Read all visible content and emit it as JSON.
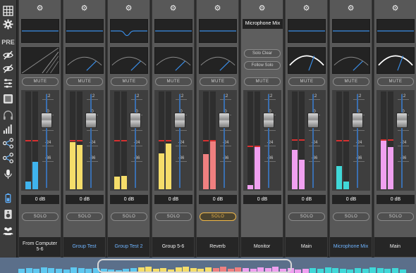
{
  "toolbar": {
    "icons": [
      "grid-icon",
      "gear-icon",
      "pre-label",
      "eye-off-icon",
      "eye-off-icon",
      "list-icon",
      "square-icon",
      "headphones-icon",
      "levels-icon",
      "routing-icon",
      "routing-icon",
      "mic-icon",
      "battery-icon",
      "speaker-icon",
      "group-icon"
    ],
    "pre_label": "PRE"
  },
  "channels": [
    {
      "name": "From Computer 5-6",
      "name_color": "white",
      "gain": "0 dB",
      "mute": "MUTE",
      "solo": "SOLO",
      "solo_active": false,
      "meter_color": "#3fb4ee",
      "meter_levels": [
        0.08,
        0.28
      ],
      "peak": 0.49,
      "fader": 0.75,
      "eq": "flat",
      "dyn": "ramp"
    },
    {
      "name": "Group Test",
      "name_color": "blue",
      "gain": "0 dB",
      "mute": "MUTE",
      "solo": "SOLO",
      "solo_active": false,
      "meter_color": "#f5dd6a",
      "meter_levels": [
        0.48,
        0.45
      ],
      "peak": 0.49,
      "fader": 0.75,
      "eq": "flat",
      "dyn": "arc"
    },
    {
      "name": "Group Test 2",
      "name_color": "blue",
      "gain": "0 dB",
      "mute": "MUTE",
      "solo": "SOLO",
      "solo_active": false,
      "meter_color": "#f5dd6a",
      "meter_levels": [
        0.13,
        0.14
      ],
      "peak": 0.49,
      "fader": 0.75,
      "eq": "dip",
      "dyn": "arc"
    },
    {
      "name": "Group 5-6",
      "name_color": "white",
      "gain": "0 dB",
      "mute": "MUTE",
      "solo": "SOLO",
      "solo_active": false,
      "meter_color": "#f5dd6a",
      "meter_levels": [
        0.37,
        0.47
      ],
      "peak": 0.49,
      "fader": 0.75,
      "eq": "flat",
      "dyn": "arc"
    },
    {
      "name": "Reverb",
      "name_color": "white",
      "gain": "0 dB",
      "mute": "MUTE",
      "solo": "SOLO",
      "solo_active": true,
      "meter_color": "#f08080",
      "meter_levels": [
        0.36,
        0.49
      ],
      "peak": 0.49,
      "fader": 0.75,
      "eq": "flat",
      "dyn": "arc"
    },
    {
      "name": "Monitor",
      "name_color": "white",
      "gain": "0 dB",
      "mute": "MUTE",
      "solo": null,
      "solo_active": false,
      "meter_color": "#f0a0f0",
      "meter_levels": [
        0.04,
        0.44
      ],
      "peak": 0.43,
      "fader": 0.75,
      "eq": "title",
      "dyn": "buttons",
      "title": "Microphone Mix",
      "solo_clear": "Solo Clear",
      "follow_solo": "Follow Solo"
    },
    {
      "name": "Main",
      "name_color": "white",
      "gain": "0 dB",
      "mute": "MUTE",
      "solo": "SOLO",
      "solo_active": false,
      "meter_color": "#f0a0f0",
      "meter_levels": [
        0.4,
        0.3
      ],
      "peak": 0.5,
      "fader": 0.75,
      "eq": "flat",
      "dyn": "arc-white"
    },
    {
      "name": "Microphone Mix",
      "name_color": "blue",
      "gain": "0 dB",
      "mute": "MUTE",
      "solo": "SOLO",
      "solo_active": false,
      "meter_color": "#40d8d8",
      "meter_levels": [
        0.24,
        0.08
      ],
      "peak": 0.49,
      "fader": 0.75,
      "eq": "flat",
      "dyn": "arc"
    },
    {
      "name": "Main",
      "name_color": "white",
      "gain": "0 dB",
      "mute": "MUTE",
      "solo": "SOLO",
      "solo_active": false,
      "meter_color": "#f0a0f0",
      "meter_levels": [
        0.5,
        0.43
      ],
      "peak": 0.5,
      "fader": 0.75,
      "eq": "flat",
      "dyn": "arc-white"
    }
  ],
  "scale_labels": [
    "12",
    "0",
    "-12",
    "-24",
    "-36"
  ],
  "overview": {
    "colors": [
      "#5fc8f0",
      "#f5dd6a",
      "#f08080",
      "#f0a0f0",
      "#40d8d8"
    ]
  }
}
